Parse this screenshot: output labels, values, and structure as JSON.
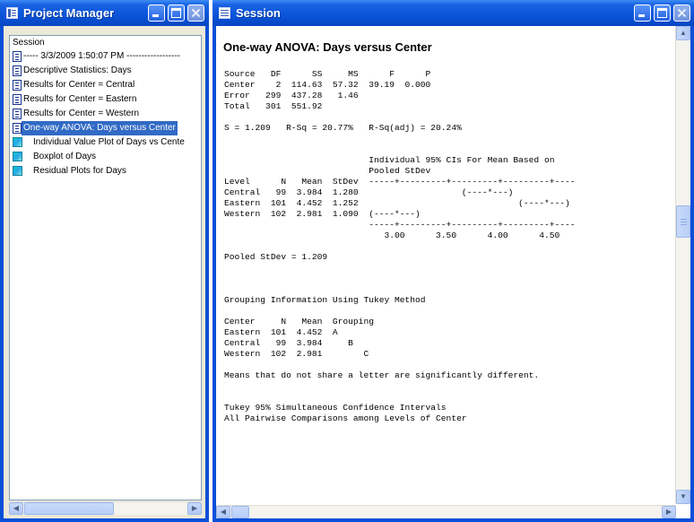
{
  "project_manager": {
    "title": "Project Manager",
    "tree_header": "Session",
    "items": [
      {
        "label": "----- 3/3/2009 1:50:07 PM ------------------",
        "icon": "document-icon",
        "selected": false
      },
      {
        "label": "Descriptive Statistics: Days",
        "icon": "document-icon",
        "selected": false
      },
      {
        "label": "Results for Center = Central",
        "icon": "document-icon",
        "selected": false
      },
      {
        "label": "Results for Center = Eastern",
        "icon": "document-icon",
        "selected": false
      },
      {
        "label": "Results for Center = Western",
        "icon": "document-icon",
        "selected": false
      },
      {
        "label": "One-way ANOVA: Days versus Center",
        "icon": "document-icon",
        "selected": true
      },
      {
        "label": "Individual Value Plot of Days vs Cente",
        "icon": "graph-icon",
        "selected": false
      },
      {
        "label": "Boxplot of Days",
        "icon": "graph-icon",
        "selected": false
      },
      {
        "label": "Residual Plots for Days",
        "icon": "graph-icon",
        "selected": false
      }
    ]
  },
  "session": {
    "title": "Session",
    "heading": "One-way ANOVA: Days versus Center",
    "lines": [
      "Source   DF      SS     MS      F      P",
      "Center    2  114.63  57.32  39.19  0.000",
      "Error   299  437.28   1.46",
      "Total   301  551.92",
      "",
      "S = 1.209   R-Sq = 20.77%   R-Sq(adj) = 20.24%",
      "",
      "",
      "                            Individual 95% CIs For Mean Based on",
      "                            Pooled StDev",
      "Level      N   Mean  StDev  -----+---------+---------+---------+----",
      "Central   99  3.984  1.280                    (----*---)",
      "Eastern  101  4.452  1.252                               (----*---)",
      "Western  102  2.981  1.090  (----*---)",
      "                            -----+---------+---------+---------+----",
      "                               3.00      3.50      4.00      4.50",
      "",
      "Pooled StDev = 1.209",
      "",
      "",
      "",
      "Grouping Information Using Tukey Method",
      "",
      "Center     N   Mean  Grouping",
      "Eastern  101  4.452  A",
      "Central   99  3.984     B",
      "Western  102  2.981        C",
      "",
      "Means that do not share a letter are significantly different.",
      "",
      "",
      "Tukey 95% Simultaneous Confidence Intervals",
      "All Pairwise Comparisons among Levels of Center"
    ]
  },
  "colors": {
    "titlebar": "#0a55db",
    "selection": "#316ac5",
    "frame": "#0a4fd8"
  }
}
